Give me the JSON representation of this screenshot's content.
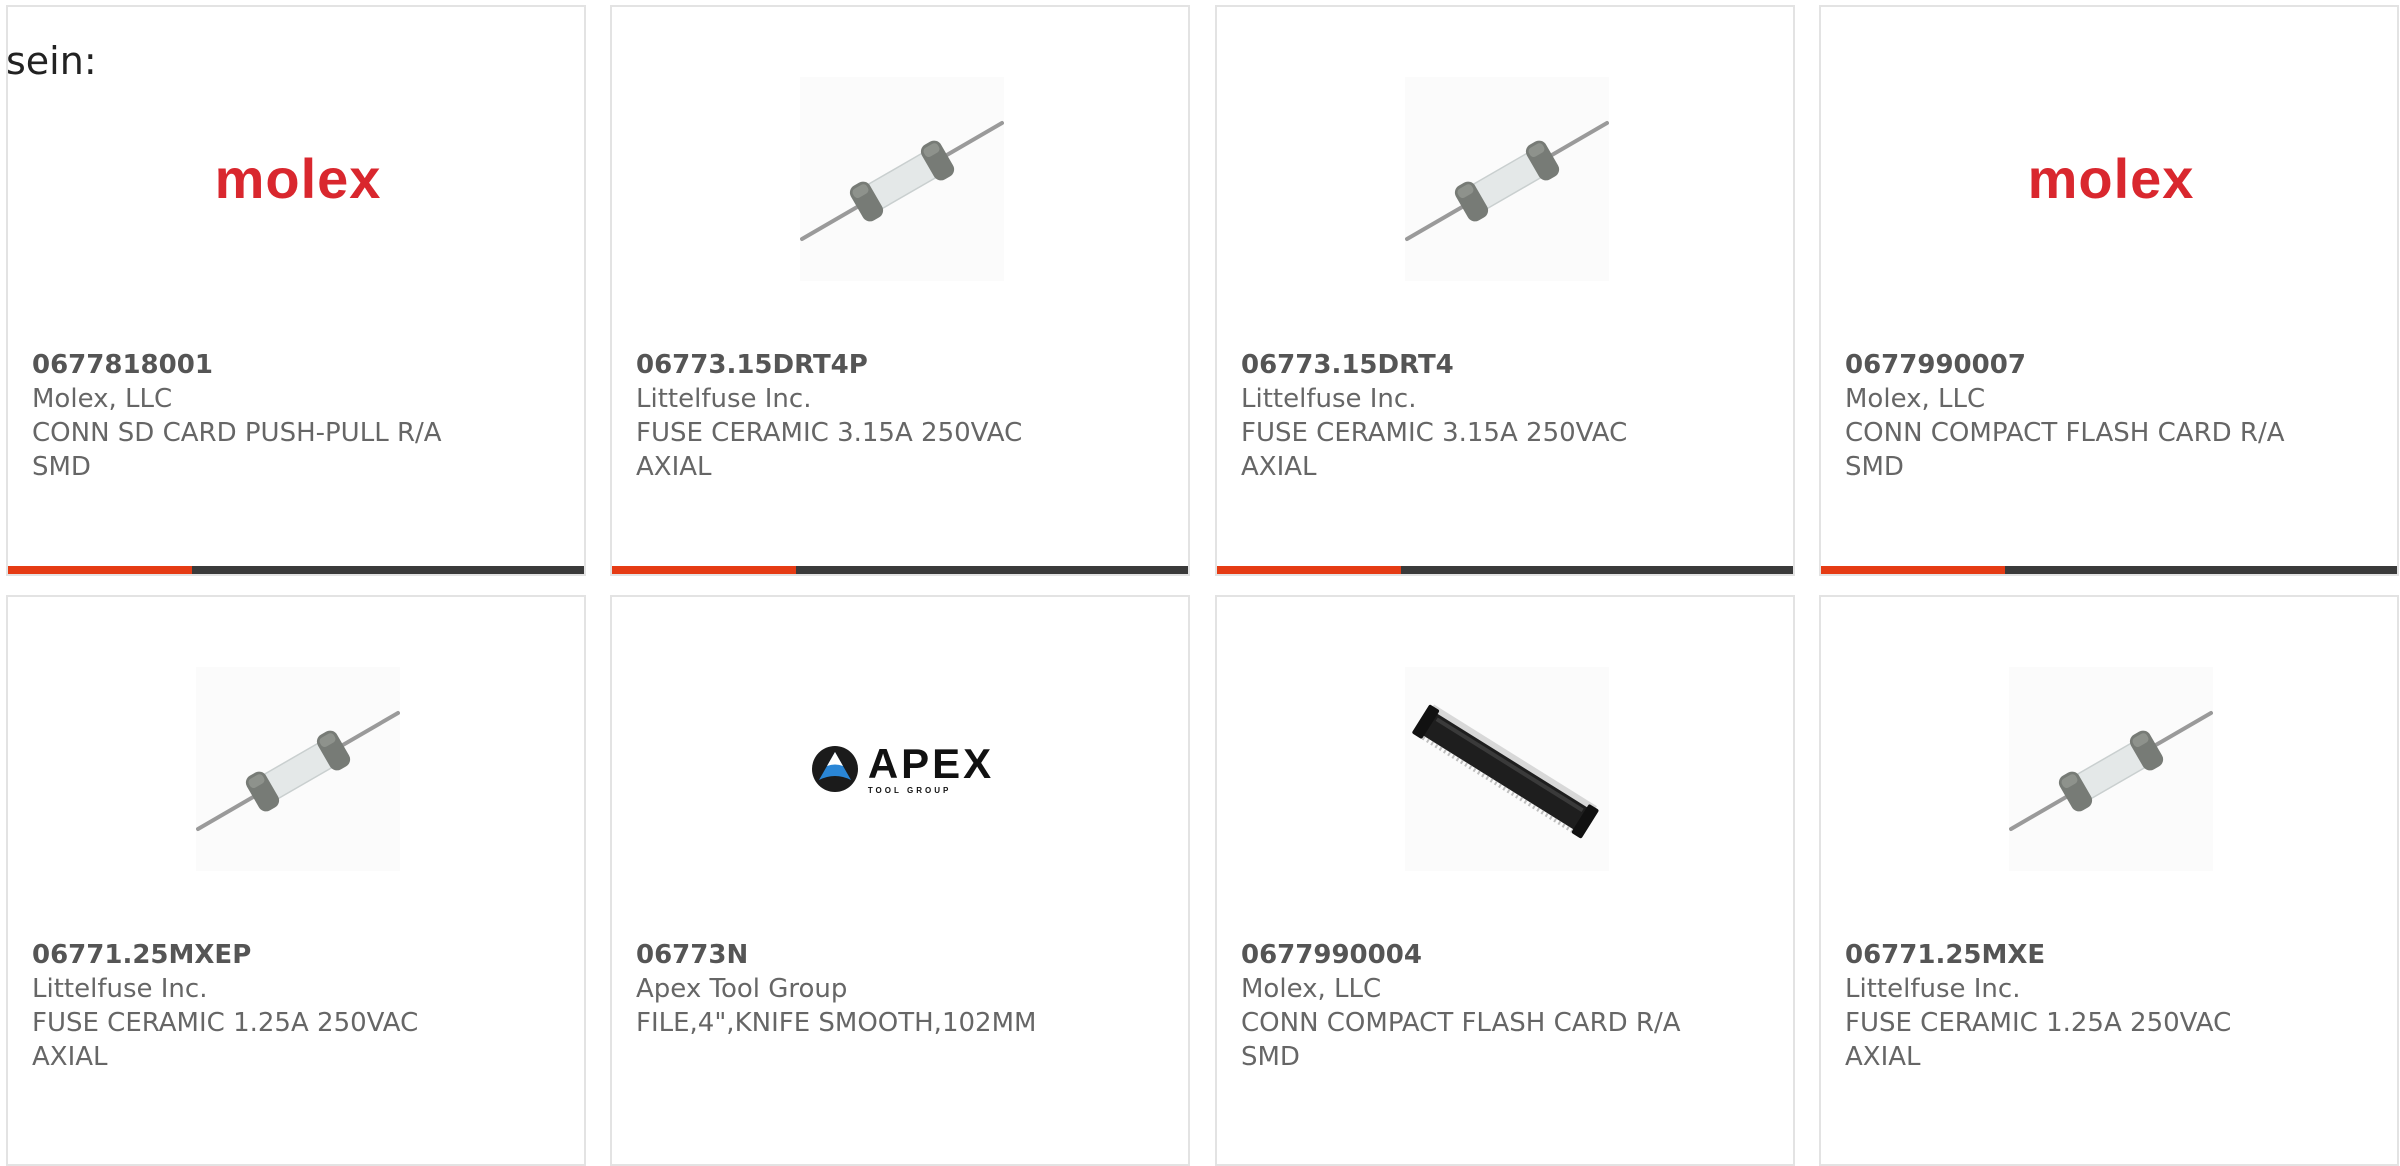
{
  "intro": "sein:",
  "colors": {
    "card_border": "#e3e3e3",
    "accent": "#e53b14",
    "bar_track": "#3a3a3a",
    "molex_red": "#d9272e"
  },
  "products": [
    {
      "part_number": "0677818001",
      "manufacturer": "Molex, LLC",
      "description": "CONN SD CARD PUSH-PULL R/A SMD",
      "image": "molex-logo",
      "progress": 0.32
    },
    {
      "part_number": "06773.15DRT4P",
      "manufacturer": "Littelfuse Inc.",
      "description": "FUSE CERAMIC 3.15A 250VAC AXIAL",
      "image": "axial-fuse",
      "progress": 0.32
    },
    {
      "part_number": "06773.15DRT4",
      "manufacturer": "Littelfuse Inc.",
      "description": "FUSE CERAMIC 3.15A 250VAC AXIAL",
      "image": "axial-fuse",
      "progress": 0.32
    },
    {
      "part_number": "0677990007",
      "manufacturer": "Molex, LLC",
      "description": "CONN COMPACT FLASH CARD R/A SMD",
      "image": "molex-logo",
      "progress": 0.32
    },
    {
      "part_number": "06771.25MXEP",
      "manufacturer": "Littelfuse Inc.",
      "description": "FUSE CERAMIC 1.25A 250VAC AXIAL",
      "image": "axial-fuse"
    },
    {
      "part_number": "06773N",
      "manufacturer": "Apex Tool Group",
      "description": "FILE,4\",KNIFE SMOOTH,102MM",
      "image": "apex-logo"
    },
    {
      "part_number": "0677990004",
      "manufacturer": "Molex, LLC",
      "description": "CONN COMPACT FLASH CARD R/A SMD",
      "image": "cf-card-connector"
    },
    {
      "part_number": "06771.25MXE",
      "manufacturer": "Littelfuse Inc.",
      "description": "FUSE CERAMIC 1.25A 250VAC AXIAL",
      "image": "axial-fuse"
    }
  ],
  "logos": {
    "molex": "molex",
    "apex": "APEX",
    "apex_sub": "TOOL GROUP"
  }
}
